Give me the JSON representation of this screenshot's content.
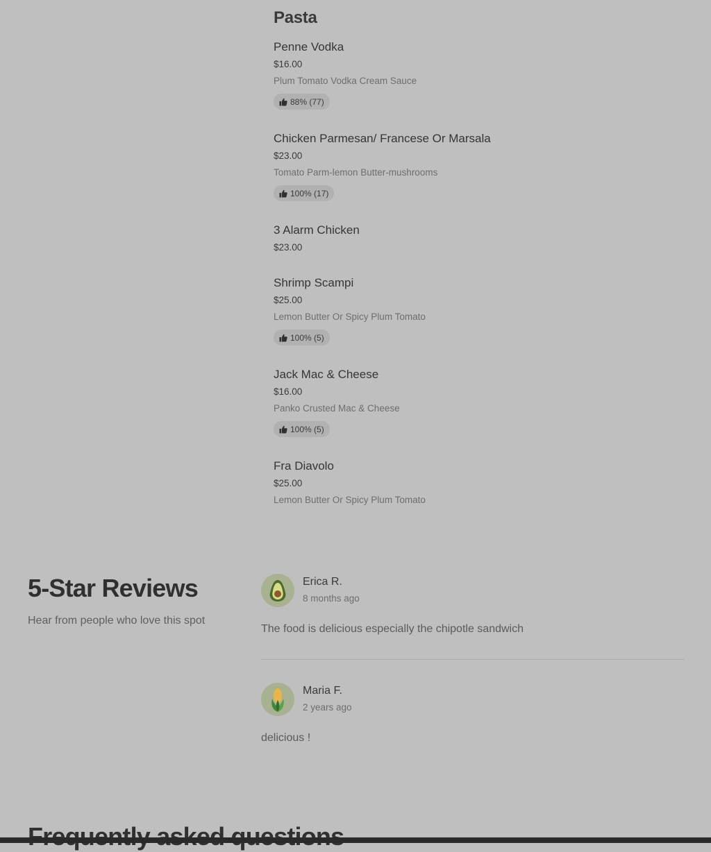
{
  "menu": {
    "section_title": "Pasta",
    "items": [
      {
        "name": "Penne Vodka",
        "price": "$16.00",
        "description": "Plum Tomato Vodka Cream Sauce",
        "rating": "88% (77)"
      },
      {
        "name": "Chicken Parmesan/ Francese Or Marsala",
        "price": "$23.00",
        "description": "Tomato Parm-lemon Butter-mushrooms",
        "rating": "100% (17)"
      },
      {
        "name": "3 Alarm Chicken",
        "price": "$23.00"
      },
      {
        "name": "Shrimp Scampi",
        "price": "$25.00",
        "description": "Lemon Butter Or Spicy Plum Tomato",
        "rating": "100% (5)"
      },
      {
        "name": "Jack Mac & Cheese",
        "price": "$16.00",
        "description": "Panko Crusted Mac & Cheese",
        "rating": "100% (5)"
      },
      {
        "name": "Fra Diavolo",
        "price": "$25.00",
        "description": "Lemon Butter Or Spicy Plum Tomato"
      }
    ]
  },
  "reviews": {
    "title": "5-Star Reviews",
    "subtitle": "Hear from people who love this spot",
    "items": [
      {
        "name": "Erica R.",
        "time": "8 months ago",
        "text": "The food is delicious especially the chipotle sandwich",
        "avatar_icon": "avocado-icon"
      },
      {
        "name": "Maria F.",
        "time": "2 years ago",
        "text": "delicious !",
        "avatar_icon": "corn-icon"
      }
    ]
  },
  "faq": {
    "title": "Frequently asked questions"
  }
}
